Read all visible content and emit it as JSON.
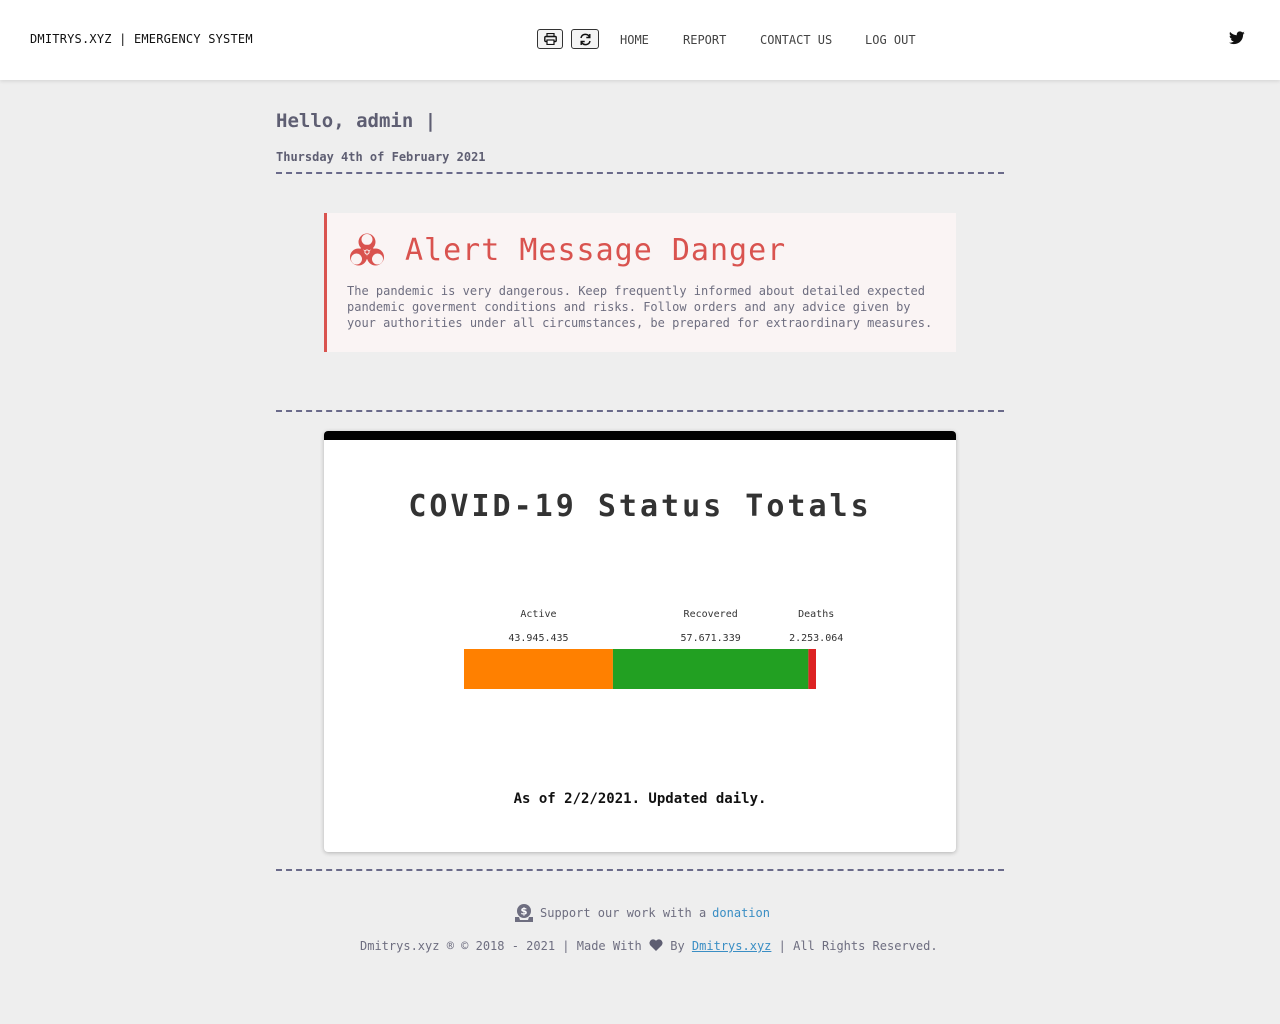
{
  "header": {
    "brand": "DMITRYS.XYZ | EMERGENCY SYSTEM",
    "buttons": [
      {
        "icon": "print-icon"
      },
      {
        "icon": "refresh-icon"
      }
    ],
    "nav": [
      "HOME",
      "REPORT",
      "CONTACT US",
      "LOG OUT"
    ],
    "social_icon": "twitter-icon"
  },
  "greeting": "Hello, admin |",
  "date": "Thursday 4th of February 2021",
  "alert": {
    "icon": "biohazard-icon",
    "title": "Alert Message Danger",
    "text": "The pandemic is very dangerous. Keep frequently informed about detailed expected pandemic goverment conditions and risks. Follow orders and any advice given by your authorities under all circumstances, be prepared for extraordinary measures.",
    "color": "#d9534f"
  },
  "status_card": {
    "title": "COVID-19 Status Totals",
    "updated": "As of 2/2/2021. Updated daily."
  },
  "chart_data": {
    "type": "bar",
    "orientation": "horizontal-stacked",
    "categories": [
      "Active",
      "Recovered",
      "Deaths"
    ],
    "value_labels": [
      "43.945.435",
      "57.671.339",
      "2.253.064"
    ],
    "values": [
      43945435,
      57671339,
      2253064
    ],
    "colors": [
      "#ff8000",
      "#22a022",
      "#dd2222"
    ]
  },
  "footer": {
    "support_text": "Support our work with a",
    "donation_link": "donation",
    "copyright": "Dmitrys.xyz ® © 2018 - 2021 | Made With",
    "by": "By",
    "author_link": "Dmitrys.xyz",
    "rights": "| All Rights Reserved."
  }
}
